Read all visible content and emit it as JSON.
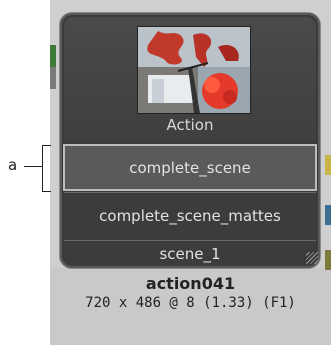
{
  "node": {
    "title": "Action",
    "outputs": [
      "complete_scene",
      "complete_scene_mattes",
      "scene_1"
    ],
    "selected_index": 0
  },
  "callout_label": "a",
  "info": {
    "name": "action041",
    "meta": "720 x 486 @ 8 (1.33) (F1)"
  },
  "colors": {
    "node_bg": "#3b3b3b",
    "selected_row": "#5a5a5a",
    "panel_bg": "#cfcfcf",
    "strip_green": "#3d7a3a",
    "strip_yellow": "#c9b44a",
    "strip_blue": "#3e6d8f",
    "strip_olive": "#7f7a3c"
  }
}
